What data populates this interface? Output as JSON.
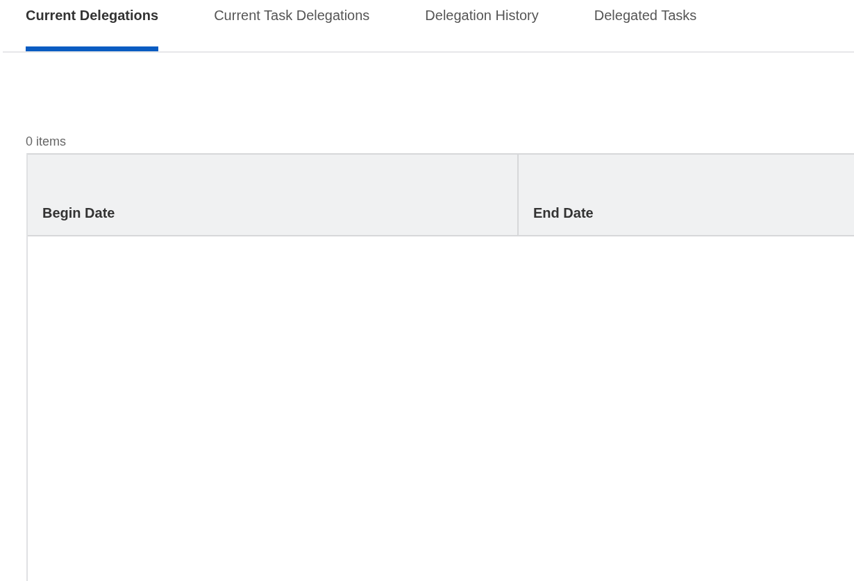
{
  "tabs": [
    {
      "label": "Current Delegations",
      "selected": true
    },
    {
      "label": "Current Task Delegations",
      "selected": false
    },
    {
      "label": "Delegation History",
      "selected": false
    },
    {
      "label": "Delegated Tasks",
      "selected": false
    }
  ],
  "item_count": "0 items",
  "table": {
    "columns": [
      "Begin Date",
      "End Date"
    ]
  }
}
